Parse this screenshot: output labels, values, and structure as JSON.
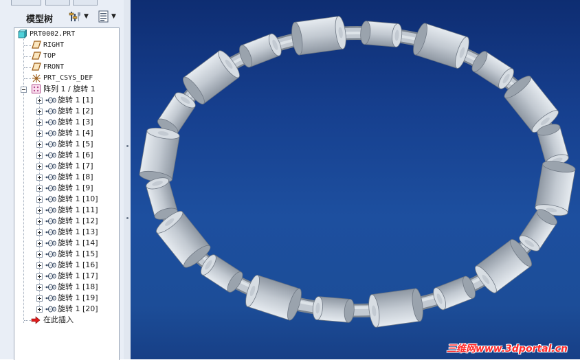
{
  "panel": {
    "title": "模型树",
    "settings_icon": "tree-settings-icon",
    "columns_icon": "tree-columns-icon"
  },
  "tree": {
    "root": "PRT0002.PRT",
    "datums": [
      "RIGHT",
      "TOP",
      "FRONT"
    ],
    "csys": "PRT_CSYS_DEF",
    "pattern": "阵列 1 / 旋转 1",
    "features": [
      "旋转 1 [1]",
      "旋转 1 [2]",
      "旋转 1 [3]",
      "旋转 1 [4]",
      "旋转 1 [5]",
      "旋转 1 [6]",
      "旋转 1 [7]",
      "旋转 1 [8]",
      "旋转 1 [9]",
      "旋转 1 [10]",
      "旋转 1 [11]",
      "旋转 1 [12]",
      "旋转 1 [13]",
      "旋转 1 [14]",
      "旋转 1 [15]",
      "旋转 1 [16]",
      "旋转 1 [17]",
      "旋转 1 [18]",
      "旋转 1 [19]",
      "旋转 1 [20]"
    ],
    "insert_here": "在此插入"
  },
  "viewport": {
    "model_description_colors": {
      "ring": "#c4cbd3",
      "background_top": "#0e2d72",
      "background_bottom": "#1d4f9f"
    },
    "watermark": "三维网www.3dportal.cn"
  }
}
